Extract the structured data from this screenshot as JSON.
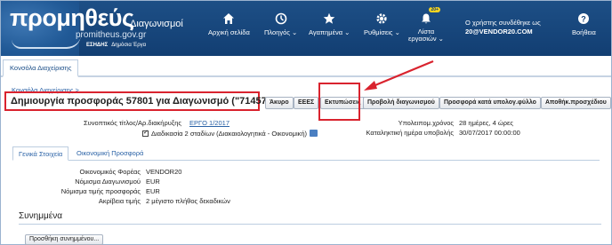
{
  "header": {
    "logo_text": "προμηθεύς",
    "logo_domain": "promitheus.gov.gr",
    "logo_esidis": "ΕΣΗΔΗΣ",
    "logo_tagline": "Δημόσια Έργα",
    "app_name": "Διαγωνισμοί",
    "nav": [
      {
        "label": "Αρχική σελίδα",
        "icon": "home-icon"
      },
      {
        "label": "Πλοηγός ⌄",
        "icon": "compass-icon"
      },
      {
        "label": "Αγαπημένα ⌄",
        "icon": "star-icon"
      },
      {
        "label": "Ρυθμίσεις ⌄",
        "icon": "gear-icon"
      },
      {
        "label": "Λίστα\nεργασιών ⌄",
        "icon": "bell-icon",
        "badge": "20+"
      }
    ],
    "user_line": "Ο χρήστης συνδέθηκε ως",
    "user_email": "20@VENDOR20.COM",
    "help_label": "Βοήθεια"
  },
  "tabs": {
    "active": "Κονσόλα Διαχείρισης"
  },
  "breadcrumb": "Κονσόλα Διαχείρισης >",
  "page_title": "Δημιουργία προσφοράς 57801 για Διαγωνισμό (\"71457\")",
  "toolbar": {
    "cancel": "Άκυρο",
    "eees": "ΕΕΕΣ",
    "print": "Εκτυπώσεις",
    "view_tender": "Προβολή διαγωνισμού",
    "offer_spreadsheet": "Προσφορά κατά υπολογ.φύλλο",
    "save_draft": "Αποθήκ.προσχέδιου"
  },
  "info": {
    "short_title_label": "Συνοπτικός τίτλος/Αρ.διακήρυξης",
    "short_title_value": "ΕΡΓΟ 1/2017",
    "process_label": "Διαδικασία 2 σταδίων (Διακαιολογητικά - Οικονομική)",
    "remaining_label": "Υπολειπομ.χρόνος",
    "remaining_value": "28 ημέρες, 4 ώρες",
    "deadline_label": "Καταληκτική ημέρα υποβολής",
    "deadline_value": "30/07/2017 00:00:00"
  },
  "subtabs": {
    "general": "Γενικά Στοιχεία",
    "financial": "Οικονομική Προσφορά"
  },
  "general": {
    "rows": [
      {
        "label": "Οικονομικός Φορέας",
        "value": "VENDOR20"
      },
      {
        "label": "Νόμισμα Διαγωνισμού",
        "value": "EUR"
      },
      {
        "label": "Νόμισμα τιμής προσφοράς",
        "value": "EUR"
      },
      {
        "label": "Ακρίβεια τιμής",
        "value": "2 μέγιστο πλήθος δεκαδικών"
      }
    ]
  },
  "attachments": {
    "title": "Συνημμένα",
    "add_button": "Προσθήκη συνημμένου..."
  },
  "colors": {
    "header_blue": "#123e72",
    "highlight_red": "#d9232e",
    "link_blue": "#2a62a6"
  }
}
